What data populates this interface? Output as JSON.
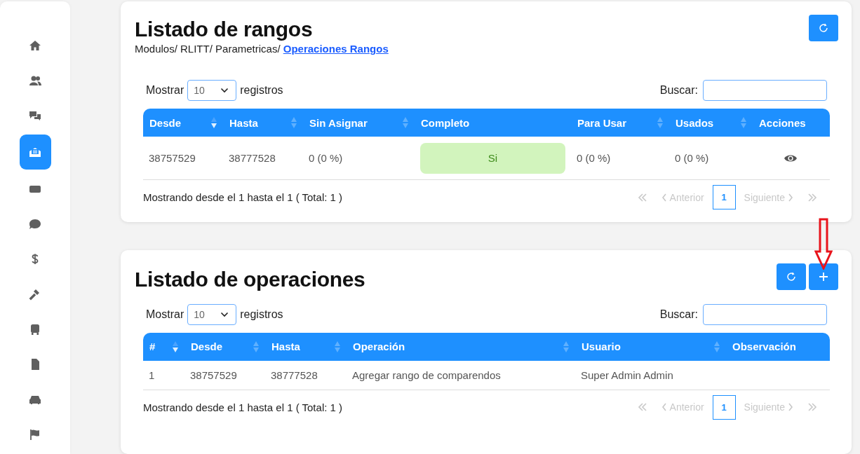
{
  "sidebar": {
    "items": [
      {
        "selected": false
      },
      {
        "selected": false
      },
      {
        "selected": false
      },
      {
        "selected": true
      },
      {
        "selected": false
      },
      {
        "selected": false
      },
      {
        "selected": false
      },
      {
        "selected": false
      },
      {
        "selected": false
      },
      {
        "selected": false
      },
      {
        "selected": false
      },
      {
        "selected": false
      }
    ]
  },
  "panels": [
    {
      "title": "Listado de rangos",
      "breadcrumb": {
        "path": "Modulos/ RLITT/ Parametricas/",
        "link": "Operaciones Rangos"
      },
      "toolbar": [
        {
          "kind": "refresh"
        }
      ],
      "length": {
        "before": "Mostrar",
        "value": "10",
        "after": "registros"
      },
      "search": {
        "label": "Buscar:"
      },
      "table": {
        "columns": [
          {
            "label": "Desde",
            "sortable": true,
            "sorted": true
          },
          {
            "label": "Hasta",
            "sortable": true,
            "sorted": false
          },
          {
            "label": "Sin Asignar",
            "sortable": true,
            "sorted": false
          },
          {
            "label": "Completo",
            "sortable": false
          },
          {
            "label": "Para Usar",
            "sortable": true,
            "sorted": false
          },
          {
            "label": "Usados",
            "sortable": true,
            "sorted": false
          },
          {
            "label": "Acciones",
            "sortable": false
          }
        ],
        "rows": [
          {
            "cells": [
              {
                "kind": "text",
                "text": "38757529"
              },
              {
                "kind": "text",
                "text": "38777528"
              },
              {
                "kind": "text",
                "text": "0 (0 %)"
              },
              {
                "kind": "badge",
                "text": "Si"
              },
              {
                "kind": "text",
                "text": "0 (0 %)"
              },
              {
                "kind": "text",
                "text": "0 (0 %)"
              },
              {
                "kind": "view"
              }
            ]
          }
        ]
      },
      "info": "Mostrando desde el 1 hasta el 1 ( Total: 1 )",
      "pagination": [
        {
          "kind": "first",
          "disabled": true
        },
        {
          "kind": "prev",
          "label": "Anterior",
          "disabled": true
        },
        {
          "kind": "page",
          "label": "1",
          "selected": true
        },
        {
          "kind": "next",
          "label": "Siguiente",
          "disabled": true
        },
        {
          "kind": "last",
          "disabled": true
        }
      ]
    },
    {
      "title": "Listado de operaciones",
      "toolbar": [
        {
          "kind": "refresh"
        },
        {
          "kind": "add"
        }
      ],
      "length": {
        "before": "Mostrar",
        "value": "10",
        "after": "registros"
      },
      "search": {
        "label": "Buscar:"
      },
      "table": {
        "columns": [
          {
            "label": "#",
            "sortable": true,
            "sorted": true
          },
          {
            "label": "Desde",
            "sortable": true,
            "sorted": false
          },
          {
            "label": "Hasta",
            "sortable": true,
            "sorted": false
          },
          {
            "label": "Operación",
            "sortable": true,
            "sorted": false
          },
          {
            "label": "Usuario",
            "sortable": true,
            "sorted": false
          },
          {
            "label": "Observación",
            "sortable": false
          }
        ],
        "rows": [
          {
            "cells": [
              {
                "kind": "text",
                "text": "1"
              },
              {
                "kind": "text",
                "text": "38757529"
              },
              {
                "kind": "text",
                "text": "38777528"
              },
              {
                "kind": "text",
                "text": "Agregar rango de comparendos"
              },
              {
                "kind": "text",
                "text": "Super Admin Admin"
              }
            ]
          }
        ]
      },
      "info": "Mostrando desde el 1 hasta el 1 ( Total: 1 )",
      "pagination": [
        {
          "kind": "first",
          "disabled": true
        },
        {
          "kind": "prev",
          "label": "Anterior",
          "disabled": true
        },
        {
          "kind": "page",
          "label": "1",
          "selected": true
        },
        {
          "kind": "next",
          "label": "Siguiente",
          "disabled": true
        },
        {
          "kind": "last",
          "disabled": true
        }
      ]
    }
  ]
}
